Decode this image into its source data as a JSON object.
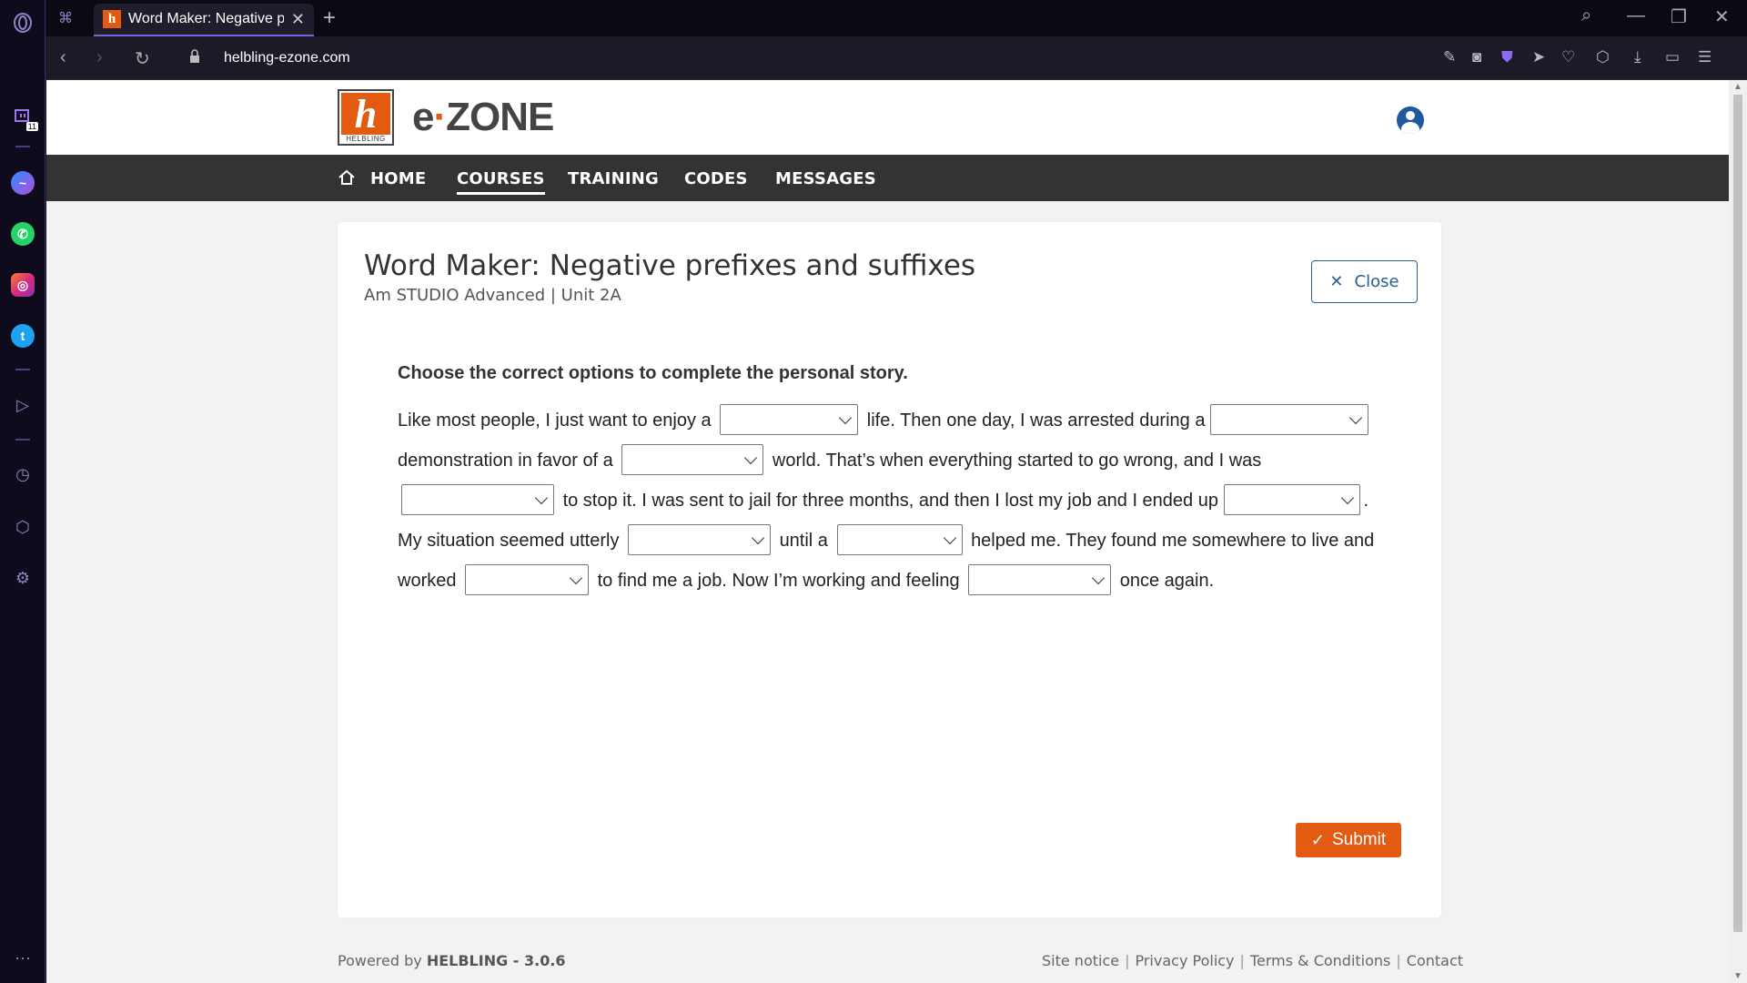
{
  "browser": {
    "tab_title": "Word Maker: Negative prefixes and suffixes",
    "url": "helbling-ezone.com",
    "sidebar_badge": "11"
  },
  "site": {
    "logo_label": "HELBLING",
    "brand": "e·zone",
    "nav": [
      "HOME",
      "COURSES",
      "TRAINING",
      "CODES",
      "MESSAGES"
    ],
    "active_nav": "COURSES"
  },
  "exercise": {
    "title": "Word Maker: Negative prefixes and suffixes",
    "subtitle": "Am STUDIO Advanced | Unit 2A",
    "close_label": "Close",
    "instruction": "Choose the correct options to complete the personal story.",
    "story_parts": [
      "Like most people, I just want to enjoy a",
      "life. Then one day, I was arrested during a",
      "demonstration in favor of a",
      "world. That’s when everything started to go wrong, and I was",
      "to stop it. I was sent to jail for three months, and then I lost my job and I ended up",
      ". My situation seemed utterly",
      "until a",
      "helped me. They found me somewhere to live and worked",
      "to find me a job. Now I’m working and feeling",
      "once again."
    ],
    "dropdown_values": [
      "",
      "",
      "",
      "",
      "",
      "",
      "",
      "",
      ""
    ],
    "submit_label": "Submit"
  },
  "footer": {
    "powered_prefix": "Powered by",
    "powered_brand": "HELBLING - 3.0.6",
    "links": [
      "Site notice",
      "Privacy Policy",
      "Terms & Conditions",
      "Contact"
    ]
  },
  "colors": {
    "accent": "#e35b10",
    "close_blue": "#2a5d94",
    "menubar": "#333333",
    "opera_purple": "#8062e0"
  }
}
